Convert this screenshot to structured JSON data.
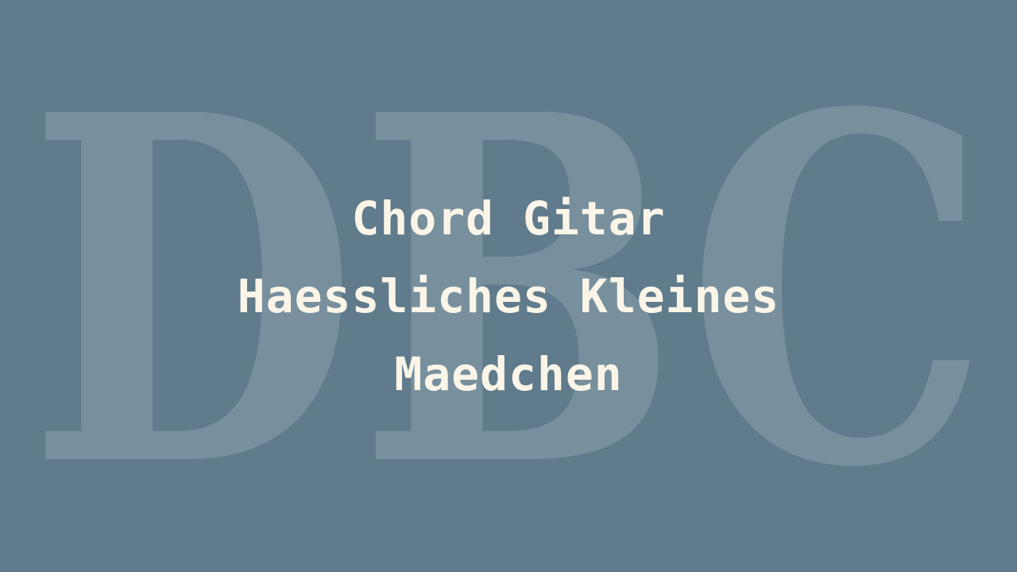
{
  "watermark": {
    "text": "DBC"
  },
  "title": {
    "lines": [
      "Chord Gitar",
      "Haessliches Kleines",
      "Maedchen"
    ]
  },
  "colors": {
    "background": "#5f7b8c",
    "title_text": "#fbf5e8",
    "watermark": "#ffffff"
  }
}
